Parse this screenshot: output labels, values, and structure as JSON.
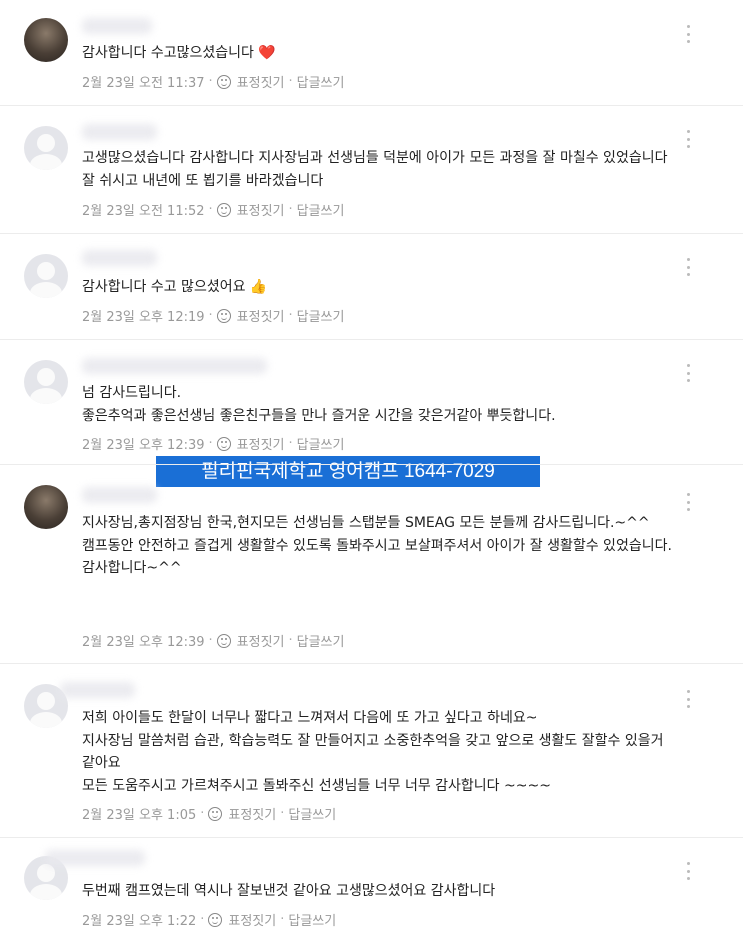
{
  "comments": [
    {
      "text": "감사합니다 수고많으셨습니다 ",
      "emoji": "❤️",
      "date": "2월 23일 오전 11:37",
      "react": "표정짓기",
      "reply": "답글쓰기"
    },
    {
      "text": "고생많으셨습니다 감사합니다  지사장님과 선생님들 덕분에 아이가 모든 과정을 잘 마칠수 있었습니다  잘 쉬시고 내년에 또 뵙기를 바라겠습니다",
      "date": "2월 23일 오전 11:52",
      "react": "표정짓기",
      "reply": "답글쓰기"
    },
    {
      "text": "감사합니다 수고 많으셨어요 ",
      "emoji": "👍",
      "date": "2월 23일 오후 12:19",
      "react": "표정짓기",
      "reply": "답글쓰기"
    },
    {
      "text": "넘 감사드립니다.\n좋은추억과 좋은선생님 좋은친구들을 만나 즐거운 시간을 갖은거같아 뿌듯합니다.",
      "date": "2월 23일 오후 12:39",
      "react": "표정짓기",
      "reply": "답글쓰기"
    },
    {
      "text": "지사장님,총지점장님  한국,현지모든 선생님들 스탭분들 SMEAG 모든 분들께 감사드립니다.~^^\n캠프동안 안전하고  즐겁게 생활할수 있도록  돌봐주시고 보살펴주셔서 아이가 잘 생활할수 있었습니다.\n감사합니다~^^",
      "date": "2월 23일 오후 12:39",
      "react": "표정짓기",
      "reply": "답글쓰기"
    },
    {
      "text": "저희 아이들도 한달이 너무나 짧다고 느껴져서 다음에 또 가고 싶다고 하네요~\n지사장님 말씀처럼 습관, 학습능력도 잘 만들어지고 소중한추억을 갖고 앞으로 생활도 잘할수 있을거같아요\n모든 도움주시고 가르쳐주시고 돌봐주신 선생님들 너무 너무 감사합니다 ~~~~",
      "date": "2월 23일 오후 1:05",
      "react": "표정짓기",
      "reply": "답글쓰기"
    },
    {
      "text": "두번째 캠프였는데 역시나 잘보낸것 같아요 고생많으셨어요 감사합니다",
      "date": "2월 23일 오후 1:22",
      "react": "표정짓기",
      "reply": "답글쓰기"
    }
  ],
  "banner": "필리핀국제학교 영어캠프 1644-7029"
}
